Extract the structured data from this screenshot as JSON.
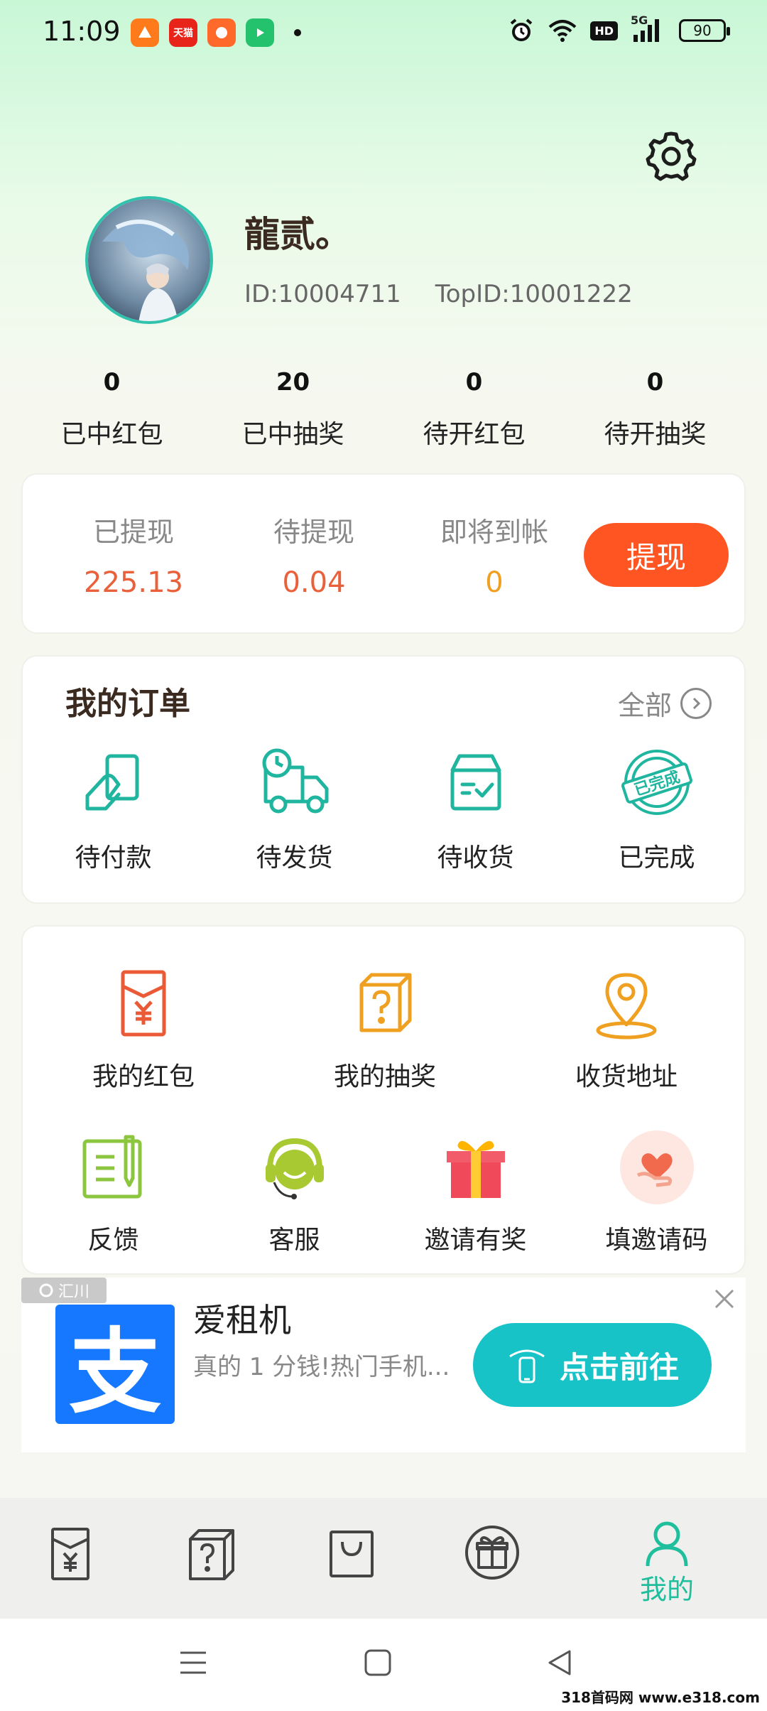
{
  "status_bar": {
    "time": "11:09",
    "app_icons": [
      "app-icon-1",
      "tmall-icon",
      "app-icon-3",
      "video-app-icon"
    ],
    "tmall_label": "天猫",
    "hd_badge": "HD",
    "network": "5G",
    "battery": "90"
  },
  "profile": {
    "nickname": "龍贰。",
    "id_text": "ID:10004711",
    "topid_text": "TopID:10001222"
  },
  "stats": [
    {
      "value": "0",
      "label": "已中红包"
    },
    {
      "value": "20",
      "label": "已中抽奖"
    },
    {
      "value": "0",
      "label": "待开红包"
    },
    {
      "value": "0",
      "label": "待开抽奖"
    }
  ],
  "withdraw": {
    "items": [
      {
        "label": "已提现",
        "value": "225.13",
        "color": "#e9603a"
      },
      {
        "label": "待提现",
        "value": "0.04",
        "color": "#e9603a"
      },
      {
        "label": "即将到帐",
        "value": "0",
        "color": "#f0a020"
      }
    ],
    "button": "提现"
  },
  "orders": {
    "title": "我的订单",
    "all_label": "全部",
    "items": [
      {
        "label": "待付款",
        "icon": "payment-pending-icon"
      },
      {
        "label": "待发货",
        "icon": "delivery-truck-icon"
      },
      {
        "label": "待收货",
        "icon": "receive-box-icon"
      },
      {
        "label": "已完成",
        "icon": "completed-stamp-icon"
      }
    ],
    "stamp_text": "已完成"
  },
  "menu": [
    {
      "label": "我的红包",
      "icon": "red-envelope-icon"
    },
    {
      "label": "我的抽奖",
      "icon": "lottery-box-icon"
    },
    {
      "label": "收货地址",
      "icon": "location-pin-icon"
    },
    {
      "label": "反馈",
      "icon": "feedback-icon"
    },
    {
      "label": "客服",
      "icon": "customer-service-icon"
    },
    {
      "label": "邀请有奖",
      "icon": "gift-icon"
    },
    {
      "label": "填邀请码",
      "icon": "heart-hand-icon"
    }
  ],
  "ad": {
    "source_label": "汇川",
    "logo_glyph": "支",
    "title": "爱租机",
    "description": "真的 1 分钱!热门手机...",
    "button": "点击前往"
  },
  "tabbar": {
    "active_label": "我的",
    "active_color": "#1fbf9e"
  },
  "watermark": "318首码网 www.e318.com"
}
